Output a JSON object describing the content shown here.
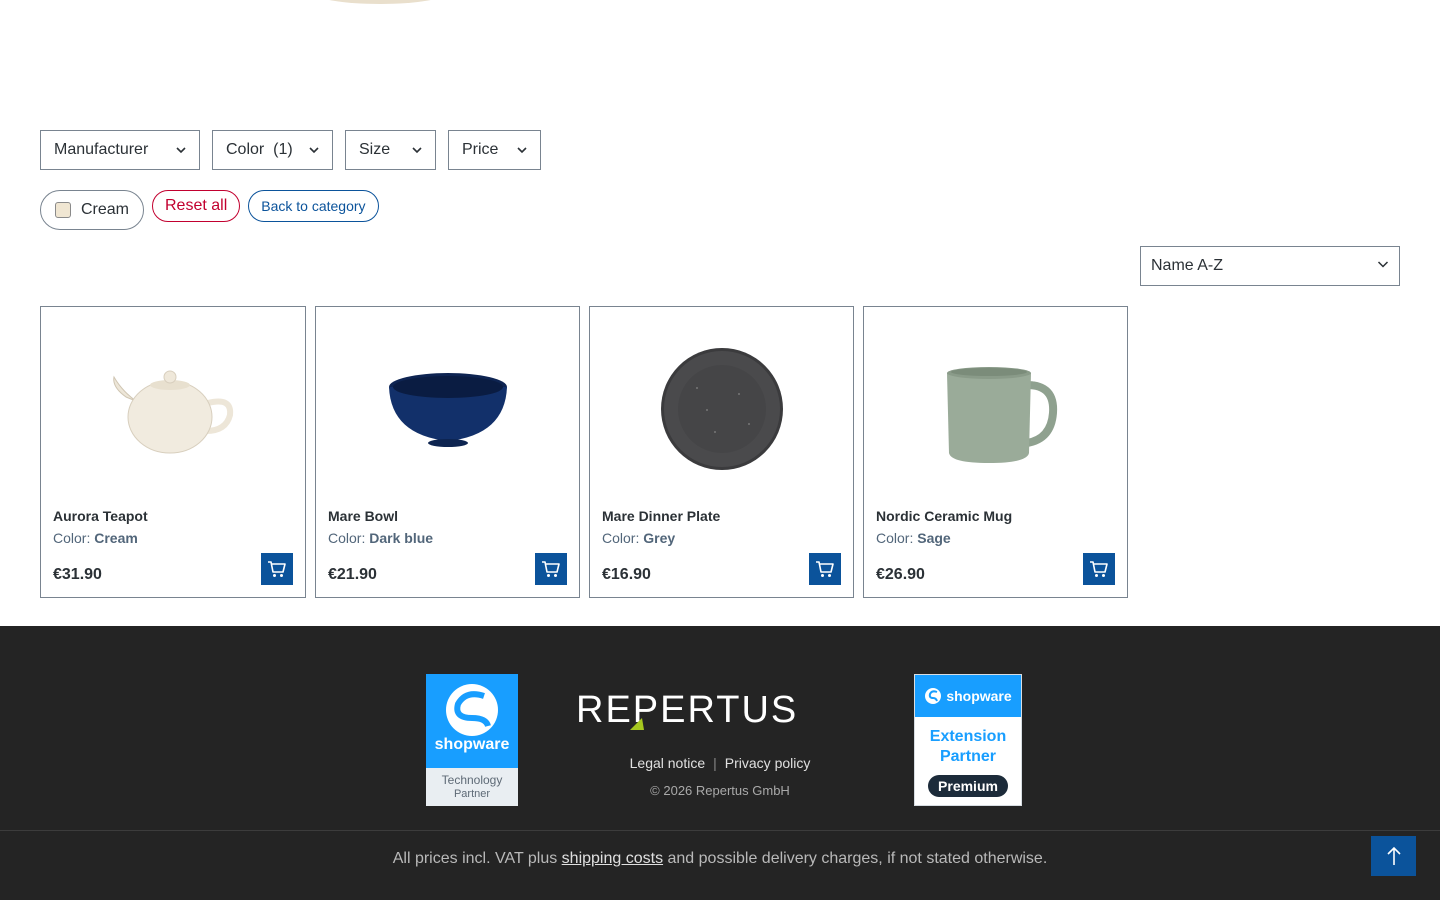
{
  "filters": {
    "manufacturer": "Manufacturer",
    "color": "Color  (1)",
    "size": "Size",
    "price": "Price"
  },
  "active_filters": {
    "cream": "Cream",
    "reset_all": "Reset all",
    "back_to_category": "Back to category"
  },
  "sort": {
    "selected": "Name A-Z"
  },
  "products": [
    {
      "name": "Aurora Teapot",
      "color_label": "Color:",
      "color_value": "Cream",
      "price": "€31.90"
    },
    {
      "name": "Mare Bowl",
      "color_label": "Color:",
      "color_value": "Dark blue",
      "price": "€21.90"
    },
    {
      "name": "Mare Dinner Plate",
      "color_label": "Color:",
      "color_value": "Grey",
      "price": "€16.90"
    },
    {
      "name": "Nordic Ceramic Mug",
      "color_label": "Color:",
      "color_value": "Sage",
      "price": "€26.90"
    }
  ],
  "footer": {
    "tech_partner_logo": "shopware",
    "tech_partner_line1": "Technology",
    "tech_partner_line2": "Partner",
    "brand": "REPERTUS",
    "legal_notice": "Legal notice",
    "privacy_policy": "Privacy policy",
    "copyright": "© 2026 Repertus GmbH",
    "ext_partner_logo": "shopware",
    "ext_partner_line1": "Extension",
    "ext_partner_line2": "Partner",
    "ext_partner_tier": "Premium",
    "vat_prefix": "All prices incl. VAT plus ",
    "vat_link": "shipping costs",
    "vat_suffix": " and possible delivery charges, if not stated otherwise."
  },
  "colors": {
    "primary": "#0b539b",
    "danger": "#c2002f",
    "footer_bg": "#242424",
    "shopware_blue": "#189eff"
  }
}
